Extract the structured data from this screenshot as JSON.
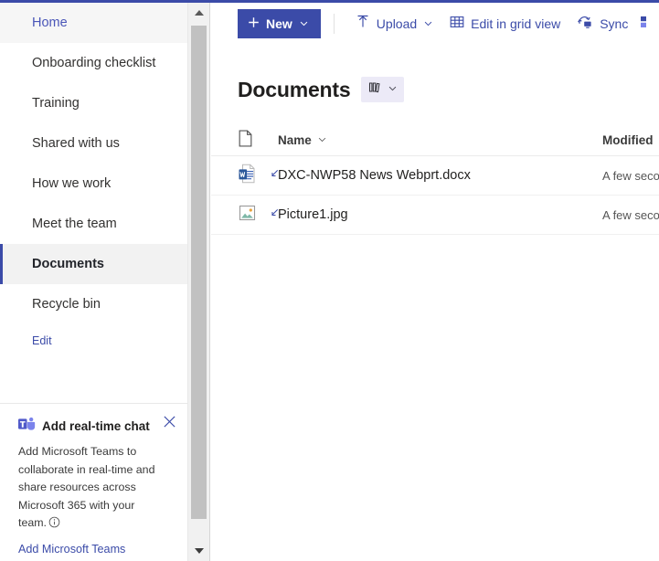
{
  "theme": {
    "accent": "#3b4ba8",
    "selected_bg": "#f2f2f2",
    "hover_bg": "#f6f6f6",
    "pill_bg": "#eceaf7"
  },
  "sidebar": {
    "items": [
      {
        "label": "Home",
        "state": "hovered"
      },
      {
        "label": "Onboarding checklist",
        "state": "normal"
      },
      {
        "label": "Training",
        "state": "normal"
      },
      {
        "label": "Shared with us",
        "state": "normal"
      },
      {
        "label": "How we work",
        "state": "normal"
      },
      {
        "label": "Meet the team",
        "state": "normal"
      },
      {
        "label": "Documents",
        "state": "selected"
      },
      {
        "label": "Recycle bin",
        "state": "normal"
      }
    ],
    "edit_label": "Edit",
    "promo": {
      "icon": "teams-icon",
      "title": "Add real-time chat",
      "body": "Add Microsoft Teams to collaborate in real-time and share resources across Microsoft 365 with your team.",
      "info_icon": "info-circle-icon",
      "link_label": "Add Microsoft Teams",
      "close_icon": "close-icon"
    }
  },
  "scrollbar": {
    "up_icon": "scroll-up-arrow-icon",
    "down_icon": "scroll-down-arrow-icon"
  },
  "commandbar": {
    "new": {
      "label": "New",
      "plus_icon": "plus-icon",
      "chevron": "chevron-down-icon"
    },
    "upload": {
      "label": "Upload",
      "icon": "upload-arrow-icon",
      "chevron": "chevron-down-icon"
    },
    "grid": {
      "label": "Edit in grid view",
      "icon": "grid-icon"
    },
    "sync": {
      "label": "Sync",
      "icon": "sync-icon"
    },
    "overflow": {
      "label": "",
      "icon": "add-shortcut-onedrive-icon"
    }
  },
  "main": {
    "title": "Documents",
    "view_switcher": {
      "icon": "list-columns-icon",
      "chevron": "chevron-down-icon"
    },
    "columns": {
      "icon_header": "file-type-icon",
      "name": "Name",
      "name_chevron": "chevron-down-icon",
      "modified": "Modified"
    },
    "files": [
      {
        "name": "DXC-NWP58 News Webprt.docx",
        "icon": "word-document-icon",
        "modified": "A few secon",
        "new_marker": "new-file-marker-icon"
      },
      {
        "name": "Picture1.jpg",
        "icon": "image-file-icon",
        "modified": "A few secon",
        "new_marker": "new-file-marker-icon"
      }
    ]
  }
}
